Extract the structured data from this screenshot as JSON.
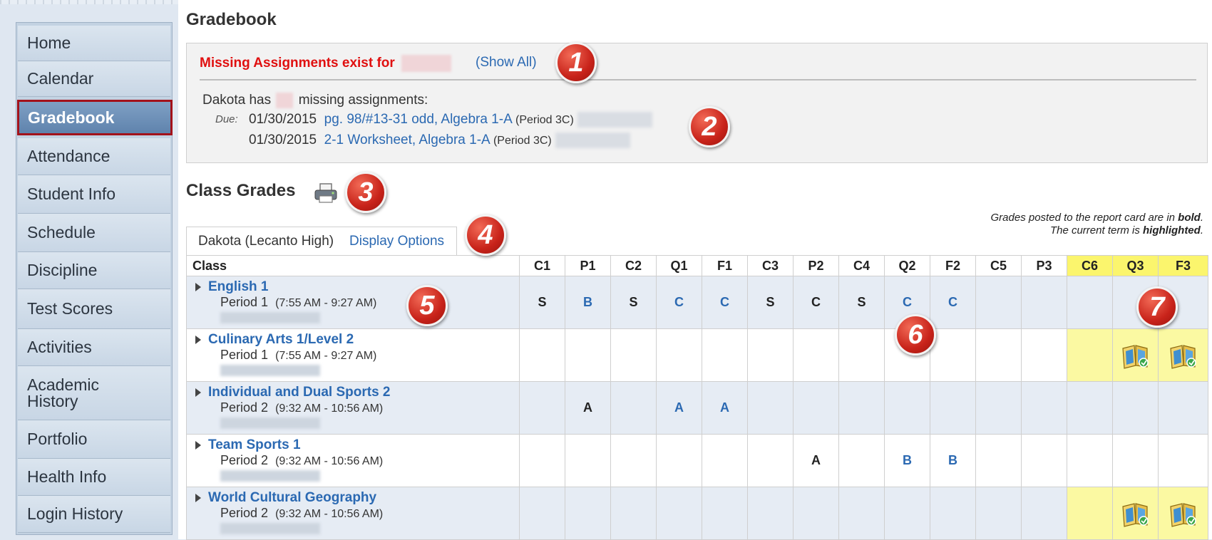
{
  "sidebar": {
    "items": [
      {
        "label": "Home",
        "active": false
      },
      {
        "label": "Calendar",
        "active": false
      },
      {
        "label": "Gradebook",
        "active": true
      },
      {
        "label": "Attendance",
        "active": false
      },
      {
        "label": "Student Info",
        "active": false
      },
      {
        "label": "Schedule",
        "active": false
      },
      {
        "label": "Discipline",
        "active": false
      },
      {
        "label": "Test Scores",
        "active": false
      },
      {
        "label": "Activities",
        "active": false
      },
      {
        "label": "Academic History",
        "active": false
      },
      {
        "label": "Portfolio",
        "active": false
      },
      {
        "label": "Health Info",
        "active": false
      },
      {
        "label": "Login History",
        "active": false
      }
    ]
  },
  "page": {
    "title": "Gradebook"
  },
  "missing": {
    "heading": "Missing Assignments exist for",
    "show_all": "(Show All)",
    "summary_prefix": "Dakota has",
    "summary_suffix": "missing assignments:",
    "due_label": "Due:",
    "assignments": [
      {
        "date": "01/30/2015",
        "title": "pg. 98/#13-31 odd, Algebra 1-A",
        "period": "(Period 3C)"
      },
      {
        "date": "01/30/2015",
        "title": "2-1 Worksheet, Algebra 1-A",
        "period": "(Period 3C)"
      }
    ]
  },
  "class_grades": {
    "title": "Class Grades",
    "printer_icon": "printer-icon",
    "legend_line1": "Grades posted to the report card are in",
    "legend_bold": "bold",
    "legend_line2": "The current term is",
    "legend_highlight": "highlighted",
    "tab_student": "Dakota (Lecanto High)",
    "tab_options": "Display Options",
    "columns": [
      "Class",
      "C1",
      "P1",
      "C2",
      "Q1",
      "F1",
      "C3",
      "P2",
      "C4",
      "Q2",
      "F2",
      "C5",
      "P3",
      "C6",
      "Q3",
      "F3"
    ],
    "current_term_columns": [
      "C6",
      "Q3",
      "F3"
    ],
    "rows": [
      {
        "name": "English 1",
        "period": "Period 1",
        "time": "(7:55 AM - 9:27 AM)",
        "grades": [
          "S",
          "B",
          "S",
          "C",
          "C",
          "S",
          "C",
          "S",
          "C",
          "C",
          "",
          "",
          "",
          "",
          ""
        ]
      },
      {
        "name": "Culinary Arts 1/Level 2",
        "period": "Period 1",
        "time": "(7:55 AM - 9:27 AM)",
        "grades": [
          "",
          "",
          "",
          "",
          "",
          "",
          "",
          "",
          "",
          "",
          "",
          "",
          "",
          "",
          ""
        ],
        "book_icons": [
          "Q3",
          "F3"
        ]
      },
      {
        "name": "Individual and Dual Sports 2",
        "period": "Period 2",
        "time": "(9:32 AM - 10:56 AM)",
        "grades": [
          "",
          "A",
          "",
          "A",
          "A",
          "",
          "",
          "",
          "",
          "",
          "",
          "",
          "",
          "",
          ""
        ]
      },
      {
        "name": "Team Sports 1",
        "period": "Period 2",
        "time": "(9:32 AM - 10:56 AM)",
        "grades": [
          "",
          "",
          "",
          "",
          "",
          "",
          "A",
          "",
          "B",
          "B",
          "",
          "",
          "",
          "",
          ""
        ]
      },
      {
        "name": "World Cultural Geography",
        "period": "Period 2",
        "time": "(9:32 AM - 10:56 AM)",
        "grades": [
          "",
          "",
          "",
          "",
          "",
          "",
          "",
          "",
          "",
          "",
          "",
          "",
          "",
          "",
          ""
        ],
        "book_icons": [
          "Q3",
          "F3"
        ]
      }
    ]
  },
  "callouts": [
    "1",
    "2",
    "3",
    "4",
    "5",
    "6",
    "7"
  ],
  "colors": {
    "accent_blue": "#2b69b2",
    "alert_red": "#e01010",
    "current_term": "#fbf56d"
  }
}
